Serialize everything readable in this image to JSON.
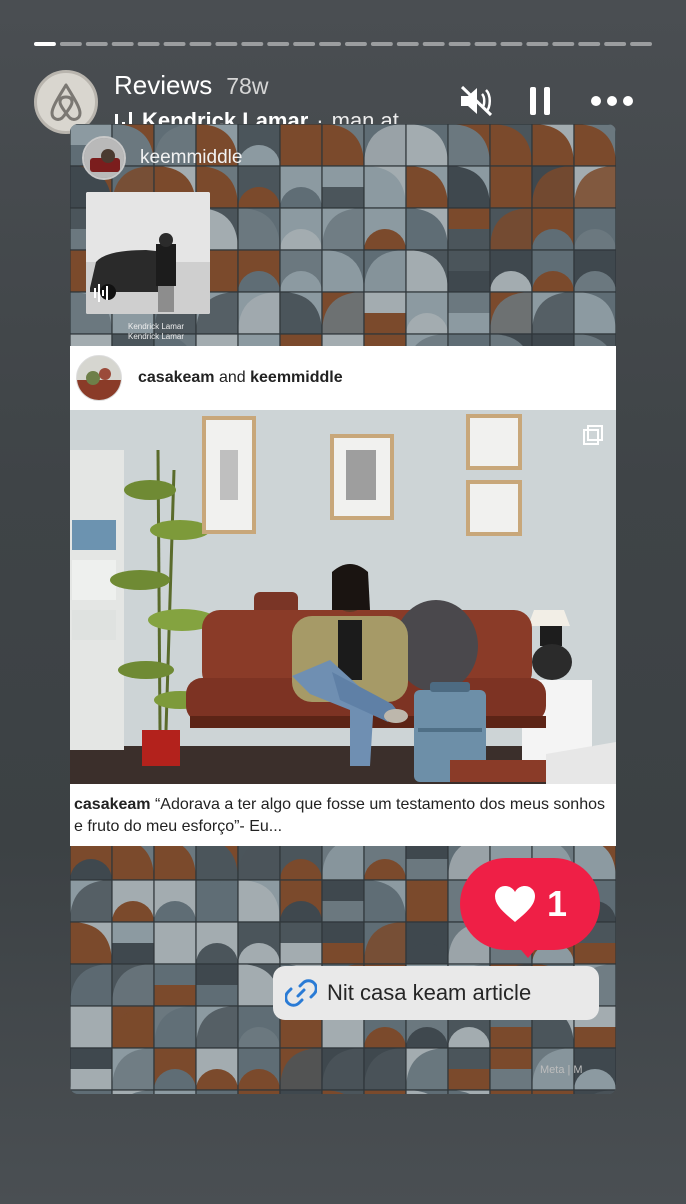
{
  "story": {
    "progress_segments": 24,
    "current_segment": 1
  },
  "header": {
    "title": "Reviews",
    "age": "78w",
    "music_artist": "Kendrick Lamar",
    "music_separator": "·",
    "music_title": "man at"
  },
  "controls": {
    "mute_icon": "muted-speaker-icon",
    "pause_icon": "pause-icon",
    "more_icon": "more-dots-icon"
  },
  "reel": {
    "username": "keemmiddle",
    "thumb_caption_line1": "Kendrick Lamar",
    "thumb_caption_line2": "Kendrick Lamar"
  },
  "post": {
    "user1": "casakeam",
    "connector": "and",
    "user2": "keemmiddle",
    "caption_user": "casakeam",
    "caption_text": "“Adorava a ter algo que fosse um testamento dos meus sonhos e fruto do meu esforço”- Eu..."
  },
  "like": {
    "count": "1"
  },
  "link": {
    "label": "Nit casa keam article"
  },
  "watermark": "Meta | M",
  "colors": {
    "like_red": "#ef1f46",
    "sofa_brown": "#8a3b28",
    "pattern_brown": "#7b4a2c",
    "pattern_slate": "#5f6d75"
  }
}
